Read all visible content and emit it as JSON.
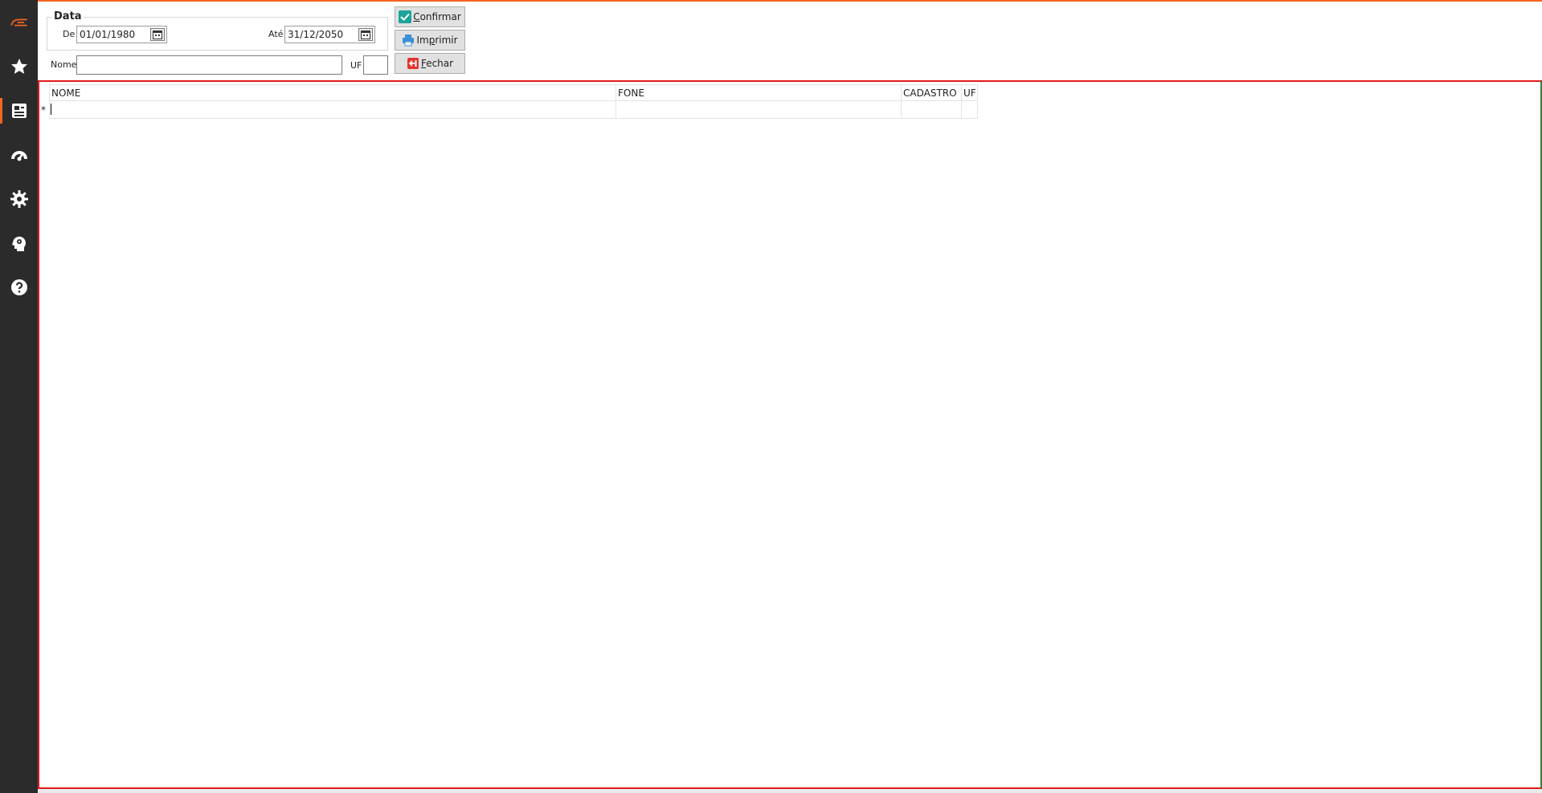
{
  "colors": {
    "accent": "#f26522",
    "sidebar": "#2b2b2b",
    "grid_border": "#e11b1b"
  },
  "sidebar": {
    "items": [
      {
        "icon": "logo-icon"
      },
      {
        "icon": "star-icon"
      },
      {
        "icon": "report-icon",
        "active": true
      },
      {
        "icon": "dashboard-icon"
      },
      {
        "icon": "gear-icon"
      },
      {
        "icon": "user-settings-icon"
      },
      {
        "icon": "help-icon"
      }
    ]
  },
  "filters": {
    "group_label": "Data",
    "from_label": "De",
    "from_value": "01/01/1980",
    "to_label": "Até",
    "to_value": "31/12/2050",
    "name_label": "Nome",
    "name_value": "",
    "uf_label": "UF",
    "uf_value": ""
  },
  "buttons": {
    "confirm": {
      "first": "C",
      "rest": "onfirmar"
    },
    "print": {
      "before": "Im",
      "underlined": "p",
      "after": "rimir"
    },
    "close": {
      "first": "F",
      "rest": "echar"
    }
  },
  "grid": {
    "columns": [
      "NOME",
      "FONE",
      "CADASTRO",
      "UF"
    ],
    "new_row_marker": "*"
  }
}
